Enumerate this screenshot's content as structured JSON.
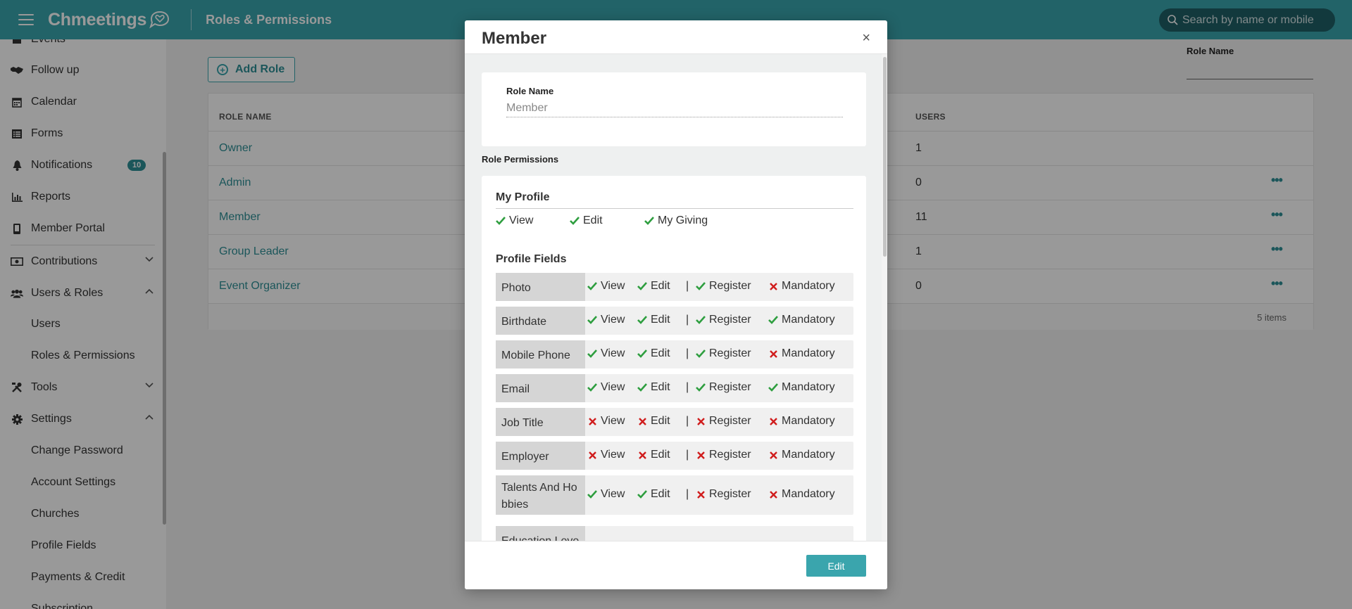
{
  "header": {
    "brand": "Chmeetings",
    "page_title": "Roles & Permissions",
    "search_placeholder": "Search by name or mobile"
  },
  "sidebar": {
    "items": [
      {
        "label": "Events",
        "icon": "calendar-event-icon"
      },
      {
        "label": "Follow up",
        "icon": "handshake-icon"
      },
      {
        "label": "Calendar",
        "icon": "calendar-icon"
      },
      {
        "label": "Forms",
        "icon": "list-icon"
      },
      {
        "label": "Notifications",
        "icon": "bell-icon",
        "badge": "10"
      },
      {
        "label": "Reports",
        "icon": "bar-chart-icon"
      },
      {
        "label": "Member Portal",
        "icon": "mobile-icon"
      },
      {
        "label": "Contributions",
        "icon": "money-icon",
        "expanded": false
      },
      {
        "label": "Users & Roles",
        "icon": "users-icon",
        "expanded": true
      },
      {
        "label": "Tools",
        "icon": "tools-icon",
        "expanded": false
      },
      {
        "label": "Settings",
        "icon": "gear-icon",
        "expanded": true
      }
    ],
    "users_roles_sub": [
      "Users",
      "Roles & Permissions"
    ],
    "settings_sub": [
      "Change Password",
      "Account Settings",
      "Churches",
      "Profile Fields",
      "Payments & Credit",
      "Subscription"
    ]
  },
  "page": {
    "add_role_label": "Add Role",
    "filter_label": "Role Name",
    "columns": [
      "ROLE NAME",
      "USERS"
    ],
    "rows": [
      {
        "name": "Owner",
        "users": "1",
        "more": false
      },
      {
        "name": "Admin",
        "users": "0",
        "more": true
      },
      {
        "name": "Member",
        "users": "11",
        "more": true
      },
      {
        "name": "Group Leader",
        "users": "1",
        "more": true
      },
      {
        "name": "Event Organizer",
        "users": "0",
        "more": true
      }
    ],
    "footer": "5 items"
  },
  "modal": {
    "title": "Member",
    "close": "×",
    "role_name_label": "Role Name",
    "role_name_value": "Member",
    "role_permissions_label": "Role Permissions",
    "my_profile": {
      "title": "My Profile",
      "options": [
        {
          "label": "View",
          "on": true
        },
        {
          "label": "Edit",
          "on": true
        },
        {
          "label": "My Giving",
          "on": true
        }
      ]
    },
    "profile_fields": {
      "title": "Profile Fields",
      "permission_labels": [
        "View",
        "Edit",
        "Register",
        "Mandatory"
      ],
      "separator": "|",
      "fields": [
        {
          "name": "Photo",
          "perms": [
            true,
            true,
            true,
            false
          ]
        },
        {
          "name": "Birthdate",
          "perms": [
            true,
            true,
            true,
            true
          ]
        },
        {
          "name": "Mobile Phone",
          "perms": [
            true,
            true,
            true,
            false
          ]
        },
        {
          "name": "Email",
          "perms": [
            true,
            true,
            true,
            true
          ]
        },
        {
          "name": "Job Title",
          "perms": [
            false,
            false,
            false,
            false
          ]
        },
        {
          "name": "Employer",
          "perms": [
            false,
            false,
            false,
            false
          ]
        },
        {
          "name": "Talents And Ho bbies",
          "perms": [
            true,
            true,
            false,
            false
          ]
        },
        {
          "name": "Education Leve",
          "perms": []
        }
      ]
    },
    "edit_label": "Edit",
    "colors": {
      "check": "#2e9e3f",
      "cross": "#d01c1c",
      "accent": "#3aa5ad"
    }
  }
}
